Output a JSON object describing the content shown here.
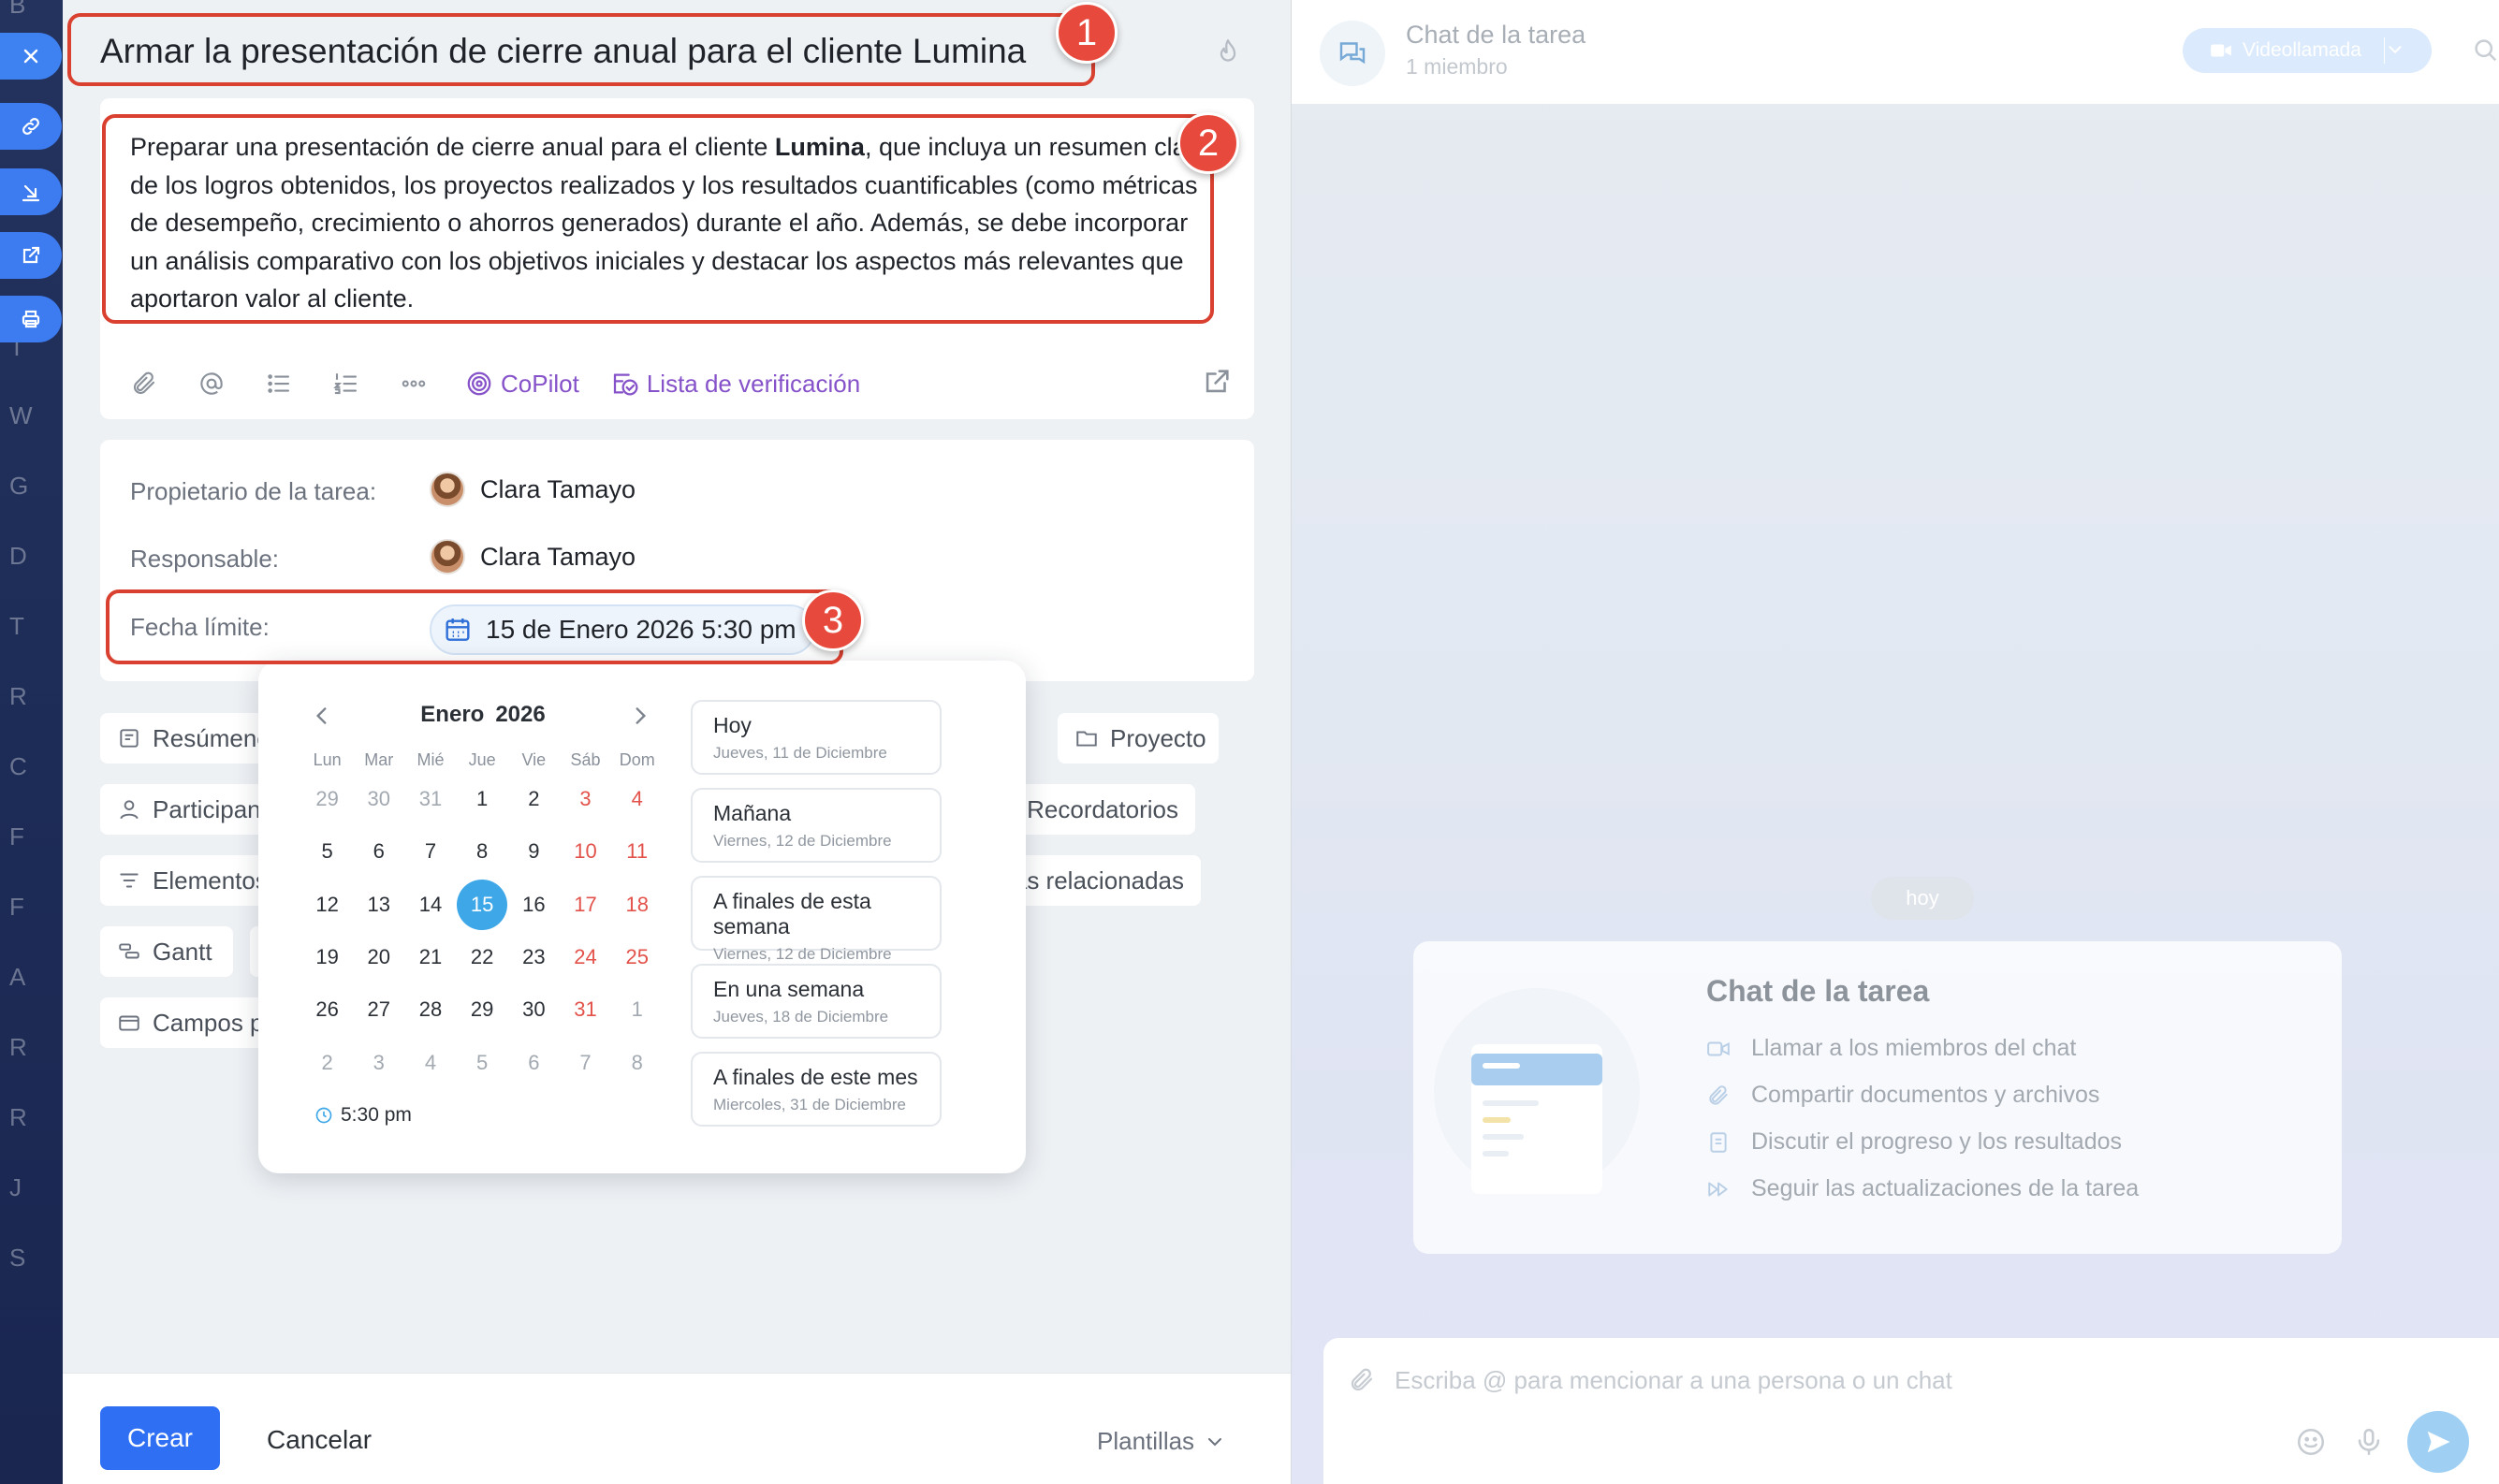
{
  "sidebar": {
    "letters": [
      "B",
      "T",
      "W",
      "G",
      "D",
      "T",
      "R",
      "C",
      "F",
      "F",
      "A",
      "R",
      "R",
      "J",
      "S"
    ],
    "float_buttons": [
      "close-icon",
      "link-icon",
      "minimize-icon",
      "open-external-icon",
      "print-icon"
    ]
  },
  "task": {
    "title": "Armar la presentación de cierre anual para el cliente Lumina",
    "description_before": "Preparar una presentación de cierre anual para el cliente ",
    "description_bold": "Lumina",
    "description_after": ", que incluya un resumen claro de los logros obtenidos, los proyectos realizados y los resultados cuantificables (como métricas de desempeño, crecimiento o ahorros generados) durante el año. Además, se debe incorporar un análisis comparativo con los objetivos iniciales y destacar los aspectos más relevantes que aportaron valor al cliente.",
    "toolbar": {
      "copilot": "CoPilot",
      "checklist": "Lista de verificación"
    }
  },
  "fields": {
    "owner_label": "Propietario de la tarea:",
    "owner_name": "Clara Tamayo",
    "responsible_label": "Responsable:",
    "responsible_name": "Clara Tamayo",
    "deadline_label": "Fecha límite:",
    "deadline_value": "15 de Enero 2026 5:30 pm"
  },
  "chips": {
    "summary": "Resúmenes",
    "project": "Proyecto",
    "participants": "Participantes",
    "reminders": "Recordatorios",
    "elements": "Elementos",
    "related": "Tareas relacionadas",
    "gantt": "Gantt",
    "custom_fields": "Campos personalizados"
  },
  "calendar": {
    "month": "Enero",
    "year": "2026",
    "weekdays": [
      "Lun",
      "Mar",
      "Mié",
      "Jue",
      "Vie",
      "Sáb",
      "Dom"
    ],
    "weeks": [
      [
        "29",
        "30",
        "31",
        "1",
        "2",
        "3",
        "4"
      ],
      [
        "5",
        "6",
        "7",
        "8",
        "9",
        "10",
        "11"
      ],
      [
        "12",
        "13",
        "14",
        "15",
        "16",
        "17",
        "18"
      ],
      [
        "19",
        "20",
        "21",
        "22",
        "23",
        "24",
        "25"
      ],
      [
        "26",
        "27",
        "28",
        "29",
        "30",
        "31",
        "1"
      ],
      [
        "2",
        "3",
        "4",
        "5",
        "6",
        "7",
        "8"
      ]
    ],
    "selected_day": "15",
    "time": "5:30 pm",
    "quick_options": [
      {
        "title": "Hoy",
        "subtitle": "Jueves, 11 de Diciembre"
      },
      {
        "title": "Mañana",
        "subtitle": "Viernes, 12 de Diciembre"
      },
      {
        "title": "A finales de esta semana",
        "subtitle": "Viernes, 12 de Diciembre"
      },
      {
        "title": "En una semana",
        "subtitle": "Jueves, 18 de Diciembre"
      },
      {
        "title": "A finales de este mes",
        "subtitle": "Miercoles, 31 de Diciembre"
      }
    ]
  },
  "footer": {
    "create": "Crear",
    "cancel": "Cancelar",
    "templates": "Plantillas"
  },
  "annotations": [
    "1",
    "2",
    "3"
  ],
  "chat": {
    "title": "Chat de la tarea",
    "members": "1 miembro",
    "video_call": "Videollamada",
    "today": "hoy",
    "card_title": "Chat de la tarea",
    "features": [
      "Llamar a los miembros del chat",
      "Compartir documentos y archivos",
      "Discutir el progreso y los resultados",
      "Seguir las actualizaciones de la tarea"
    ],
    "composer_placeholder": "Escriba @ para mencionar a una persona o un chat"
  },
  "colors": {
    "accent_blue": "#2f6ff3",
    "annotation_red": "#e8493d",
    "copilot_purple": "#8652c9",
    "selected_day": "#3ea7e8",
    "weekend_red": "#e3524a"
  }
}
